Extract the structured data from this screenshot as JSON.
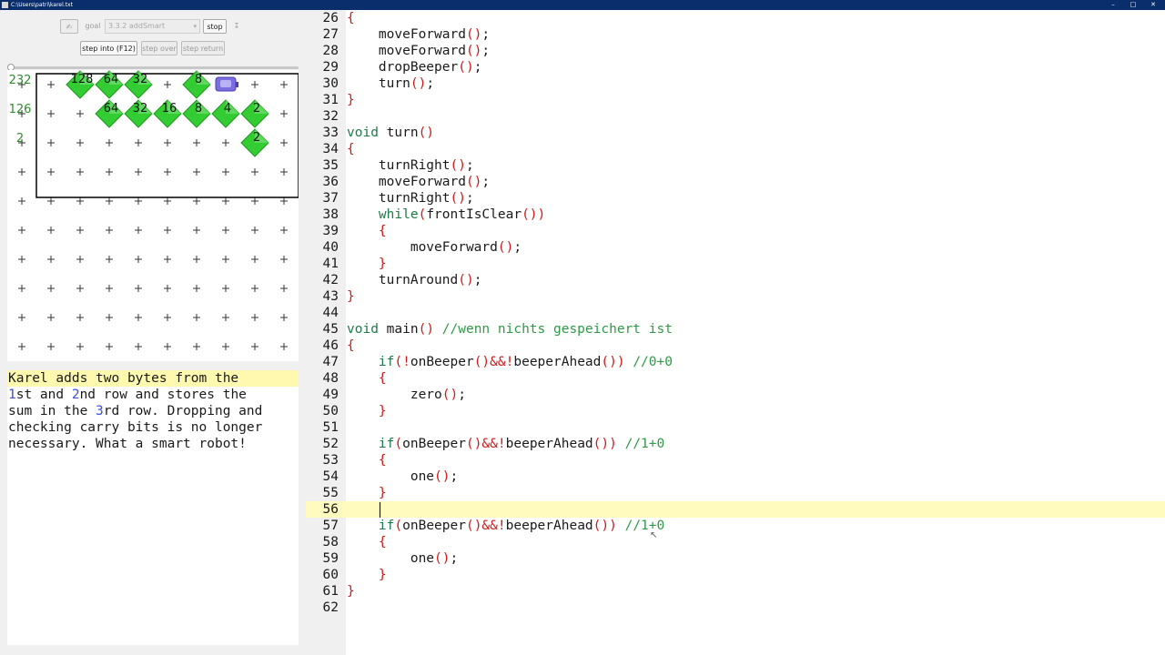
{
  "window": {
    "title": "C:\\Users\\patri\\karel.txt",
    "controls": [
      "–",
      "□",
      "✕"
    ]
  },
  "toolbar": {
    "goal_label": "goal",
    "goal_value": "3.3.2 addSmart",
    "stop_label": "stop",
    "step_into_label": "step into (F12)",
    "step_over_label": "step over",
    "step_return_label": "step return"
  },
  "world": {
    "beepers": [
      {
        "row": 0,
        "col": 0,
        "value": "232"
      },
      {
        "row": 0,
        "col": 2,
        "value": "128"
      },
      {
        "row": 0,
        "col": 3,
        "value": "64"
      },
      {
        "row": 0,
        "col": 4,
        "value": "32"
      },
      {
        "row": 0,
        "col": 6,
        "value": "8"
      },
      {
        "row": 1,
        "col": 0,
        "value": "126"
      },
      {
        "row": 1,
        "col": 3,
        "value": "64"
      },
      {
        "row": 1,
        "col": 4,
        "value": "32"
      },
      {
        "row": 1,
        "col": 5,
        "value": "16"
      },
      {
        "row": 1,
        "col": 6,
        "value": "8"
      },
      {
        "row": 1,
        "col": 7,
        "value": "4"
      },
      {
        "row": 1,
        "col": 8,
        "value": "2"
      },
      {
        "row": 2,
        "col": 0,
        "value": "2"
      },
      {
        "row": 2,
        "col": 8,
        "value": "2"
      }
    ],
    "karel": {
      "row": 0,
      "col": 7,
      "facing": "east"
    },
    "colors": {
      "beeper": "#33cc33",
      "beeper_dark": "#1f9a1f",
      "karel": "#7a6ee0",
      "wall": "#000000",
      "label": "#2e8b2e"
    }
  },
  "description": {
    "lines": [
      [
        {
          "text": "Karel adds two bytes from the",
          "cls": ""
        }
      ],
      [
        {
          "text": "1",
          "cls": "num"
        },
        {
          "text": "st and ",
          "cls": ""
        },
        {
          "text": "2",
          "cls": "num"
        },
        {
          "text": "nd row and stores the",
          "cls": ""
        }
      ],
      [
        {
          "text": "sum in the ",
          "cls": ""
        },
        {
          "text": "3",
          "cls": "num"
        },
        {
          "text": "rd row. Dropping and",
          "cls": ""
        }
      ],
      [
        {
          "text": "checking carry bits is no longer",
          "cls": ""
        }
      ],
      [
        {
          "text": "necessary. What a smart robot!",
          "cls": ""
        }
      ]
    ],
    "highlight_line": 0
  },
  "editor": {
    "first_line": 26,
    "highlight_line": 56,
    "lines": [
      [
        [
          "{",
          "punc"
        ]
      ],
      [
        [
          "    moveForward",
          "plain"
        ],
        [
          "()",
          "punc"
        ],
        [
          ";",
          "plain"
        ]
      ],
      [
        [
          "    moveForward",
          "plain"
        ],
        [
          "()",
          "punc"
        ],
        [
          ";",
          "plain"
        ]
      ],
      [
        [
          "    dropBeeper",
          "plain"
        ],
        [
          "()",
          "punc"
        ],
        [
          ";",
          "plain"
        ]
      ],
      [
        [
          "    turn",
          "plain"
        ],
        [
          "()",
          "punc"
        ],
        [
          ";",
          "plain"
        ]
      ],
      [
        [
          "}",
          "punc"
        ]
      ],
      [],
      [
        [
          "void",
          "kw"
        ],
        [
          " turn",
          "plain"
        ],
        [
          "()",
          "punc"
        ]
      ],
      [
        [
          "{",
          "punc"
        ]
      ],
      [
        [
          "    turnRight",
          "plain"
        ],
        [
          "()",
          "punc"
        ],
        [
          ";",
          "plain"
        ]
      ],
      [
        [
          "    moveForward",
          "plain"
        ],
        [
          "()",
          "punc"
        ],
        [
          ";",
          "plain"
        ]
      ],
      [
        [
          "    turnRight",
          "plain"
        ],
        [
          "()",
          "punc"
        ],
        [
          ";",
          "plain"
        ]
      ],
      [
        [
          "    ",
          "plain"
        ],
        [
          "while",
          "kw"
        ],
        [
          "(",
          "punc"
        ],
        [
          "frontIsClear",
          "plain"
        ],
        [
          "())",
          "punc"
        ]
      ],
      [
        [
          "    ",
          "plain"
        ],
        [
          "{",
          "punc"
        ]
      ],
      [
        [
          "        moveForward",
          "plain"
        ],
        [
          "()",
          "punc"
        ],
        [
          ";",
          "plain"
        ]
      ],
      [
        [
          "    ",
          "plain"
        ],
        [
          "}",
          "punc"
        ]
      ],
      [
        [
          "    turnAround",
          "plain"
        ],
        [
          "()",
          "punc"
        ],
        [
          ";",
          "plain"
        ]
      ],
      [
        [
          "}",
          "punc"
        ]
      ],
      [],
      [
        [
          "void",
          "kw"
        ],
        [
          " main",
          "plain"
        ],
        [
          "()",
          "punc"
        ],
        [
          " ",
          "plain"
        ],
        [
          "//wenn nichts gespeichert ist",
          "cm"
        ]
      ],
      [
        [
          "{",
          "punc"
        ]
      ],
      [
        [
          "    ",
          "plain"
        ],
        [
          "if",
          "kw"
        ],
        [
          "(!",
          "punc"
        ],
        [
          "onBeeper",
          "plain"
        ],
        [
          "()&&!",
          "punc"
        ],
        [
          "beeperAhead",
          "plain"
        ],
        [
          "())",
          "punc"
        ],
        [
          " ",
          "plain"
        ],
        [
          "//0+0",
          "cm"
        ]
      ],
      [
        [
          "    ",
          "plain"
        ],
        [
          "{",
          "punc"
        ]
      ],
      [
        [
          "        zero",
          "plain"
        ],
        [
          "()",
          "punc"
        ],
        [
          ";",
          "plain"
        ]
      ],
      [
        [
          "    ",
          "plain"
        ],
        [
          "}",
          "punc"
        ]
      ],
      [],
      [
        [
          "    ",
          "plain"
        ],
        [
          "if",
          "kw"
        ],
        [
          "(",
          "punc"
        ],
        [
          "onBeeper",
          "plain"
        ],
        [
          "()&&!",
          "punc"
        ],
        [
          "beeperAhead",
          "plain"
        ],
        [
          "())",
          "punc"
        ],
        [
          " ",
          "plain"
        ],
        [
          "//1+0",
          "cm"
        ]
      ],
      [
        [
          "    ",
          "plain"
        ],
        [
          "{",
          "punc"
        ]
      ],
      [
        [
          "        one",
          "plain"
        ],
        [
          "()",
          "punc"
        ],
        [
          ";",
          "plain"
        ]
      ],
      [
        [
          "    ",
          "plain"
        ],
        [
          "}",
          "punc"
        ]
      ],
      [],
      [
        [
          "    ",
          "plain"
        ],
        [
          "if",
          "kw"
        ],
        [
          "(",
          "punc"
        ],
        [
          "onBeeper",
          "plain"
        ],
        [
          "()&&!",
          "punc"
        ],
        [
          "beeperAhead",
          "plain"
        ],
        [
          "())",
          "punc"
        ],
        [
          " ",
          "plain"
        ],
        [
          "//1+0",
          "cm"
        ]
      ],
      [
        [
          "    ",
          "plain"
        ],
        [
          "{",
          "punc"
        ]
      ],
      [
        [
          "        one",
          "plain"
        ],
        [
          "()",
          "punc"
        ],
        [
          ";",
          "plain"
        ]
      ],
      [
        [
          "    ",
          "plain"
        ],
        [
          "}",
          "punc"
        ]
      ],
      [
        [
          "}",
          "punc"
        ]
      ],
      []
    ]
  }
}
